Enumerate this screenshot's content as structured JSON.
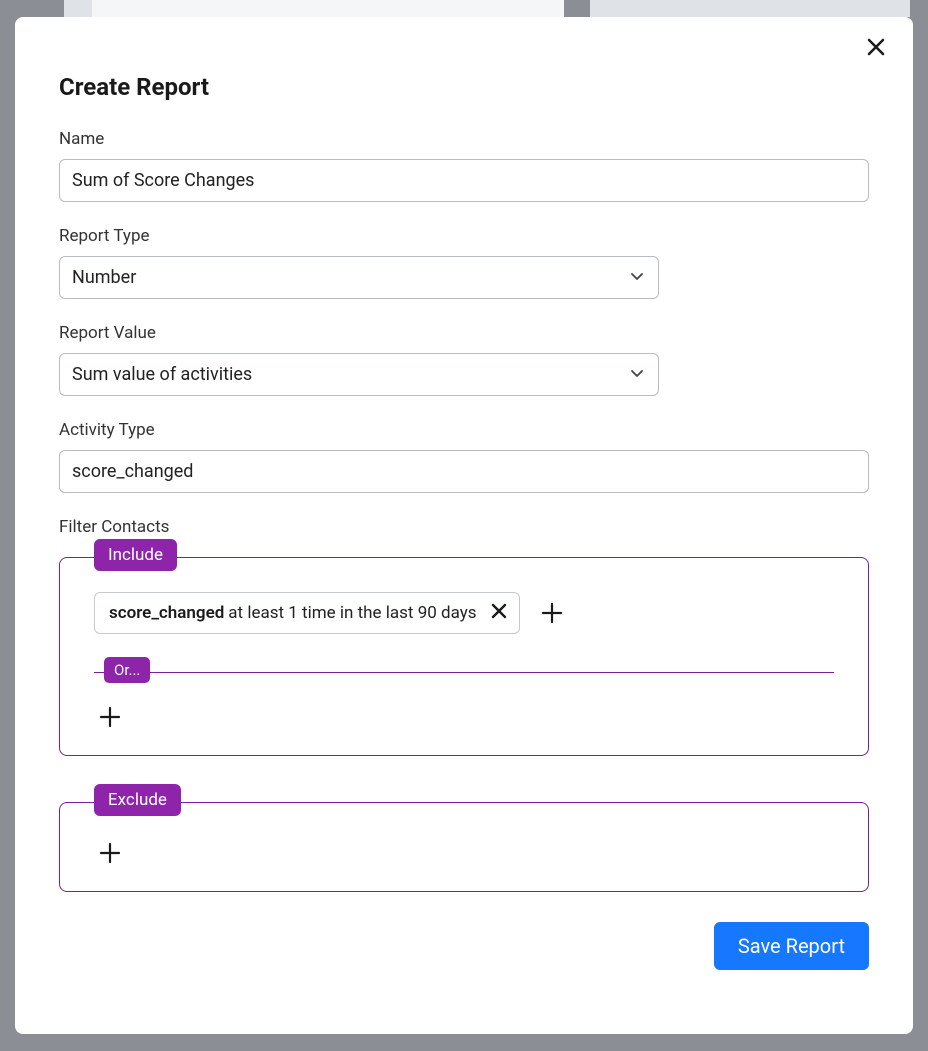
{
  "modal": {
    "title": "Create Report",
    "fields": {
      "name": {
        "label": "Name",
        "value": "Sum of Score Changes"
      },
      "report_type": {
        "label": "Report Type",
        "value": "Number"
      },
      "report_value": {
        "label": "Report Value",
        "value": "Sum value of activities"
      },
      "activity_type": {
        "label": "Activity Type",
        "value": "score_changed"
      }
    },
    "filter": {
      "label": "Filter Contacts",
      "include": {
        "badge": "Include",
        "or_label": "Or...",
        "condition": {
          "bold": "score_changed",
          "rest": " at least 1 time in the last 90 days"
        }
      },
      "exclude": {
        "badge": "Exclude"
      }
    },
    "save_label": "Save Report"
  }
}
